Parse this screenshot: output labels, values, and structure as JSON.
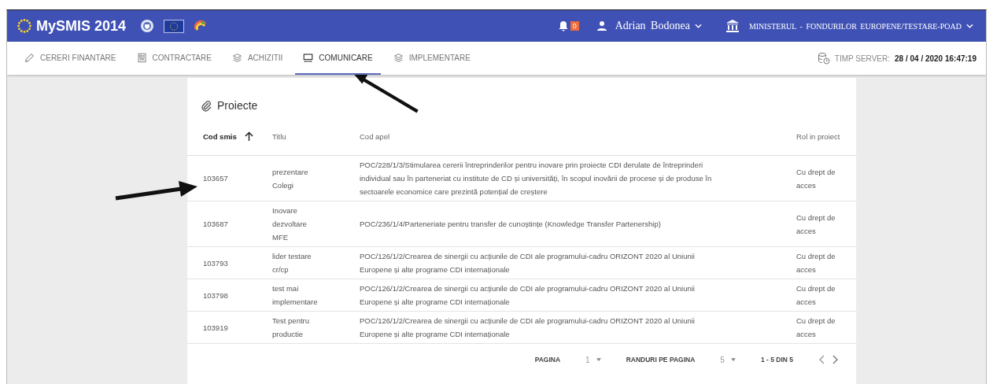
{
  "header": {
    "logo_text": "MySMIS 2014",
    "notifications": "0",
    "user": "Adrian Bodonea",
    "organization": "MINISTERUL - FONDURILOR EUROPENE/TESTARE-POAD"
  },
  "tabs": [
    {
      "label": "CERERI FINANTARE",
      "kind": "pencil",
      "selected": false
    },
    {
      "label": "CONTRACTARE",
      "kind": "document",
      "selected": false
    },
    {
      "label": "ACHIZITII",
      "kind": "layers",
      "selected": false
    },
    {
      "label": "COMUNICARE",
      "kind": "monitor",
      "selected": true
    },
    {
      "label": "IMPLEMENTARE",
      "kind": "layers",
      "selected": false
    }
  ],
  "server_time": {
    "label": "TIMP SERVER:",
    "value": "28 / 04 / 2020 16:47:19"
  },
  "card": {
    "title": "Proiecte"
  },
  "table": {
    "columns": [
      {
        "label": "Cod smis",
        "sorted": true
      },
      {
        "label": "Titlu",
        "sorted": false
      },
      {
        "label": "Cod apel",
        "sorted": false
      },
      {
        "label": "Rol in proiect",
        "sorted": false
      }
    ],
    "rows": [
      {
        "cod_smis": "103657",
        "titlu": "prezentare Colegi",
        "cod_apel": "POC/228/1/3/Stimularea cererii întreprinderilor pentru inovare prin proiecte CDI derulate de întreprinderi individual sau în parteneriat cu institute de CD și universități, în scopul inovării de procese și de produse în sectoarele economice care prezintă potențial de creștere",
        "rol": "Cu drept de acces"
      },
      {
        "cod_smis": "103687",
        "titlu": "Inovare dezvoltare MFE",
        "cod_apel": "POC/236/1/4/Parteneriate pentru transfer de cunoștințe (Knowledge Transfer Partenership)",
        "rol": "Cu drept de acces"
      },
      {
        "cod_smis": "103793",
        "titlu": "lider testare cr/cp",
        "cod_apel": "POC/126/1/2/Crearea de sinergii cu acțiunile de CDI ale programului-cadru ORIZONT 2020 al Uniunii Europene și alte programe CDI internaționale",
        "rol": "Cu drept de acces"
      },
      {
        "cod_smis": "103798",
        "titlu": "test mai implementare",
        "cod_apel": "POC/126/1/2/Crearea de sinergii cu acțiunile de CDI ale programului-cadru ORIZONT 2020 al Uniunii Europene și alte programe CDI internaționale",
        "rol": "Cu drept de acces"
      },
      {
        "cod_smis": "103919",
        "titlu": "Test pentru productie",
        "cod_apel": "POC/126/1/2/Crearea de sinergii cu acțiunile de CDI ale programului-cadru ORIZONT 2020 al Uniunii Europene și alte programe CDI internaționale",
        "rol": "Cu drept de acces"
      }
    ]
  },
  "pagination": {
    "page_label": "PAGINA",
    "page": "1",
    "rows_label": "RANDURI PE PAGINA",
    "rows_per_page": "5",
    "range": "1 - 5 DIN 5"
  }
}
